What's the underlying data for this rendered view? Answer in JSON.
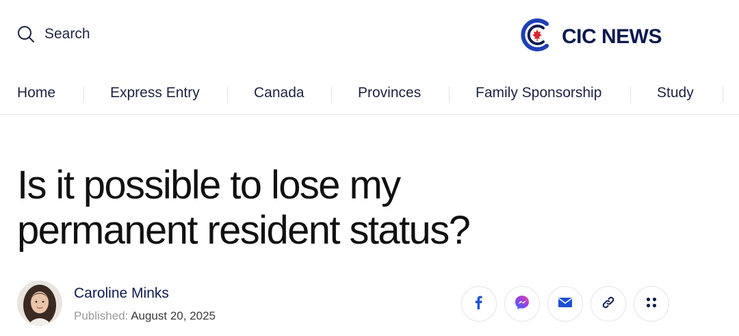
{
  "header": {
    "search_label": "Search",
    "logo_text": "CIC NEWS"
  },
  "nav": {
    "items": [
      {
        "label": "Home"
      },
      {
        "label": "Express Entry"
      },
      {
        "label": "Canada"
      },
      {
        "label": "Provinces"
      },
      {
        "label": "Family Sponsorship"
      },
      {
        "label": "Study"
      }
    ]
  },
  "article": {
    "title_line1": "Is it possible to lose my",
    "title_line2": "permanent resident status?",
    "author": "Caroline Minks",
    "published_label": "Published:",
    "published_date": "August 20, 2025"
  },
  "share_buttons": [
    {
      "icon": "facebook-icon"
    },
    {
      "icon": "messenger-icon"
    },
    {
      "icon": "email-icon"
    },
    {
      "icon": "link-icon"
    },
    {
      "icon": "more-icon"
    }
  ],
  "colors": {
    "brand_navy": "#0e1a4f",
    "brand_blue": "#1f3fb8",
    "maple_red": "#d8262b",
    "share_icon_blue": "#1e50d6"
  }
}
